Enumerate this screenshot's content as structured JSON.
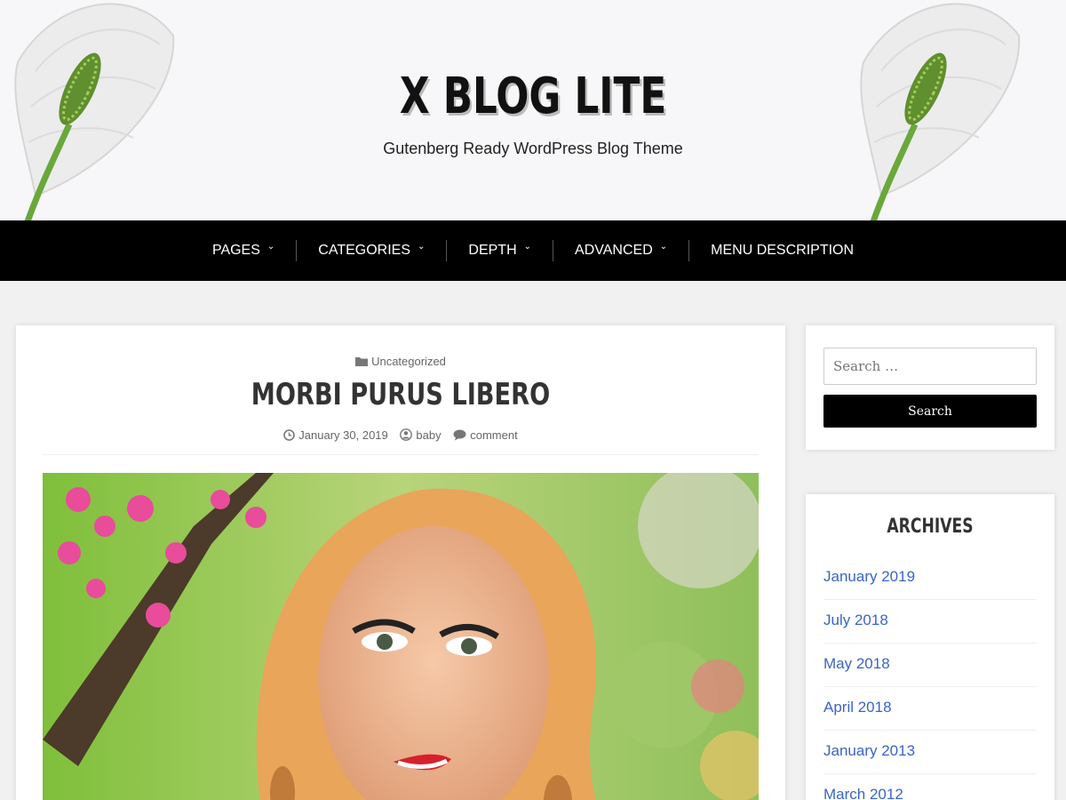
{
  "header": {
    "site_title": "X BLOG LITE",
    "tagline": "Gutenberg Ready WordPress Blog Theme"
  },
  "nav": {
    "items": [
      {
        "label": "PAGES",
        "has_dropdown": true
      },
      {
        "label": "CATEGORIES",
        "has_dropdown": true
      },
      {
        "label": "DEPTH",
        "has_dropdown": true
      },
      {
        "label": "ADVANCED",
        "has_dropdown": true
      },
      {
        "label": "MENU DESCRIPTION",
        "has_dropdown": false
      }
    ]
  },
  "post": {
    "category": "Uncategorized",
    "title": "MORBI PURUS LIBERO",
    "date": "January 30, 2019",
    "author": "baby",
    "comments": "comment"
  },
  "sidebar": {
    "search": {
      "placeholder": "Search …",
      "button_label": "Search"
    },
    "archives": {
      "title": "ARCHIVES",
      "items": [
        "January 2019",
        "July 2018",
        "May 2018",
        "April 2018",
        "January 2013",
        "March 2012"
      ]
    }
  },
  "colors": {
    "nav_background": "#000000",
    "link": "#3a64c6",
    "heading": "#333333"
  },
  "icons": {
    "category": "folder-icon",
    "date": "clock-icon",
    "author": "user-icon",
    "comments": "comment-icon",
    "dropdown": "chevron-down-icon"
  }
}
